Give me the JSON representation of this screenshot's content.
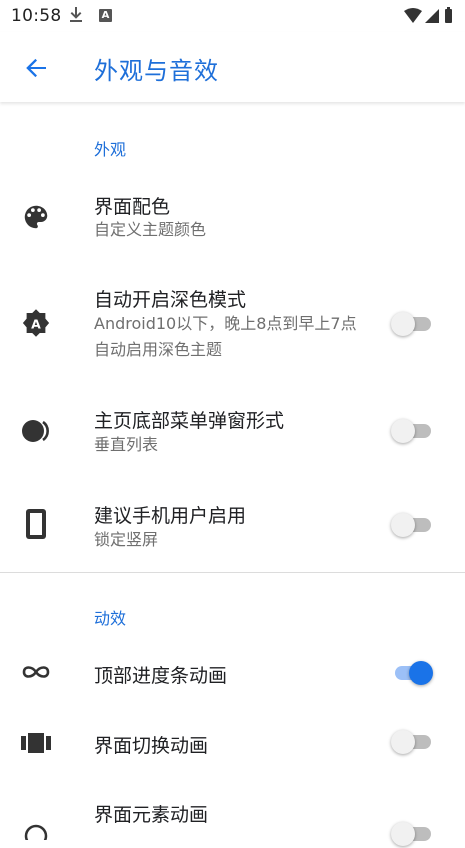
{
  "status_bar": {
    "time": "10:58",
    "badge": "A"
  },
  "app_bar": {
    "title": "外观与音效"
  },
  "sections": {
    "appearance": "外观",
    "animation": "动效"
  },
  "settings": {
    "theme_color": {
      "title": "界面配色",
      "subtitle": "自定义主题颜色"
    },
    "auto_dark": {
      "title": "自动开启深色模式",
      "subtitle": "Android10以下，晚上8点到早上7点自动启用深色主题",
      "enabled": false
    },
    "home_menu_popup": {
      "title": "主页底部菜单弹窗形式",
      "subtitle": "垂直列表",
      "enabled": false
    },
    "phone_user": {
      "title": "建议手机用户启用",
      "subtitle": "锁定竖屏",
      "enabled": false
    },
    "top_progress_anim": {
      "title": "顶部进度条动画",
      "enabled": true
    },
    "page_switch_anim": {
      "title": "界面切换动画",
      "enabled": false
    },
    "element_anim": {
      "title": "界面元素动画",
      "enabled": false
    }
  },
  "colors": {
    "accent": "#1a73e8",
    "title_blue": "#1e6fd9"
  }
}
